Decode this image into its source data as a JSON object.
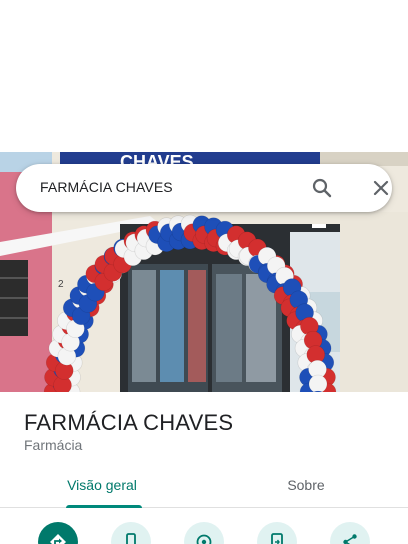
{
  "search": {
    "query": "FARMÁCIA CHAVES",
    "search_icon": "search-icon",
    "clear_icon": "close-icon"
  },
  "photo": {
    "signage_text": "CHAVES",
    "door_number": "2"
  },
  "place": {
    "name": "FARMÁCIA CHAVES",
    "category": "Farmácia"
  },
  "tabs": [
    {
      "label": "Visão geral",
      "selected": true
    },
    {
      "label": "Sobre",
      "selected": false
    }
  ],
  "actions": [
    {
      "icon": "directions-icon",
      "primary": true
    },
    {
      "icon": "phone-icon",
      "primary": false
    },
    {
      "icon": "location-share-icon",
      "primary": false
    },
    {
      "icon": "send-to-phone-icon",
      "primary": false
    },
    {
      "icon": "share-icon",
      "primary": false
    }
  ],
  "colors": {
    "accent": "#00796b",
    "accent_light": "#e0f2f1",
    "balloon_red": "#d32f2f",
    "balloon_blue": "#1e4fb8",
    "balloon_white": "#f4f4f4",
    "text_primary": "#202124",
    "text_secondary": "#70757a"
  }
}
